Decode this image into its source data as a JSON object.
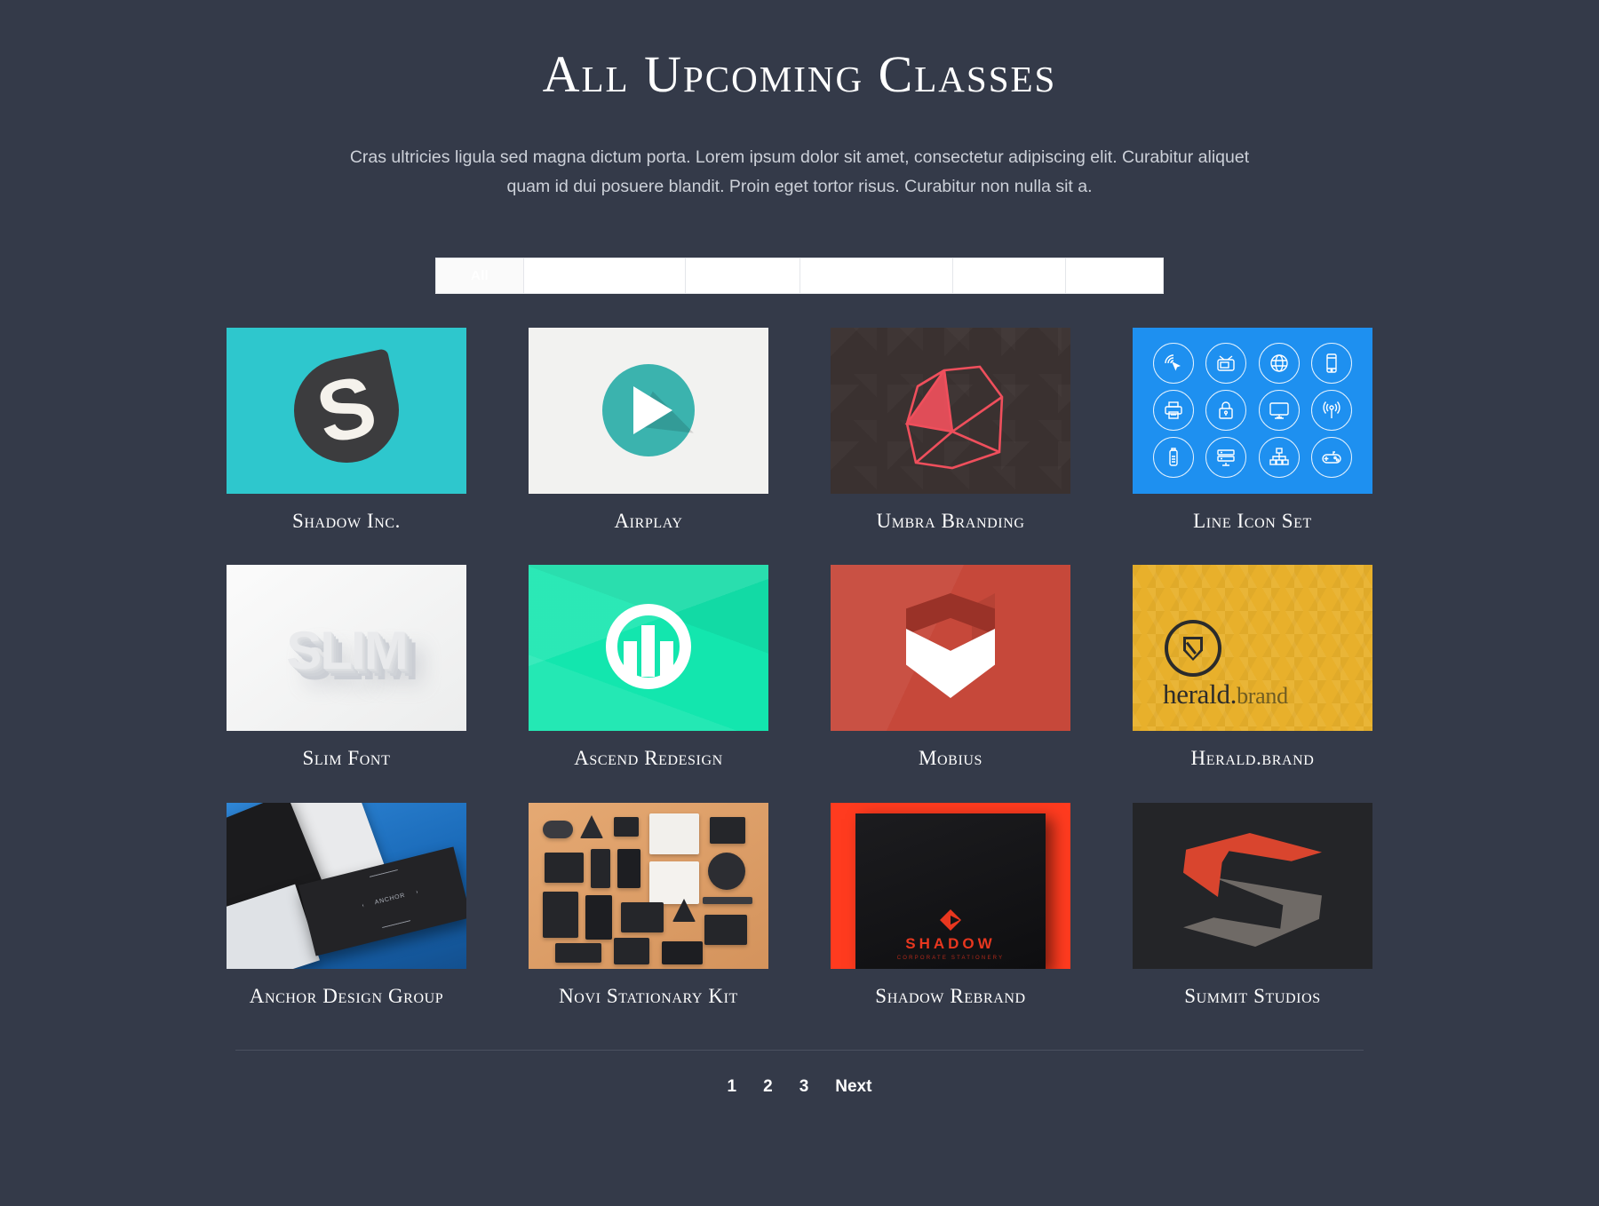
{
  "header": {
    "title": "All Upcoming Classes",
    "intro": "Cras ultricies ligula sed magna dictum porta. Lorem ipsum dolor sit amet, consectetur adipiscing elit. Curabitur aliquet quam id dui posuere blandit. Proin eget tortor risus. Curabitur non nulla sit a."
  },
  "filters": {
    "active": "All",
    "items": [
      {
        "label": "All",
        "active": true
      },
      {
        "label": "",
        "active": false
      },
      {
        "label": "",
        "active": false
      },
      {
        "label": "",
        "active": false
      },
      {
        "label": "",
        "active": false
      },
      {
        "label": "",
        "active": false
      }
    ]
  },
  "cards": [
    {
      "title": "Shadow Inc.",
      "art": "shadow-inc-logo",
      "bg": "#2ec7cd",
      "letter": "S"
    },
    {
      "title": "Airplay",
      "art": "airplay-play-button",
      "bg": "#f2f2f0",
      "accent": "#3bb3ae"
    },
    {
      "title": "Umbra Branding",
      "art": "umbra-wireframe-polyhedron",
      "bg": "#3a3130",
      "accent": "#ef4f5c"
    },
    {
      "title": "Line Icon Set",
      "art": "line-icon-grid",
      "bg": "#1e90f0",
      "icons": [
        "touch-cursor-icon",
        "tv-icon",
        "globe-icon",
        "smartphone-icon",
        "printer-icon",
        "lock-icon",
        "monitor-icon",
        "wifi-antenna-icon",
        "usb-drive-icon",
        "server-icon",
        "sitemap-icon",
        "gamepad-icon"
      ]
    },
    {
      "title": "Slim Font",
      "art": "slim-embossed-type",
      "bg": "#f3f3f3",
      "word": "SLIM"
    },
    {
      "title": "Ascend Redesign",
      "art": "ascend-circle-mark",
      "bg": "#13e6ae"
    },
    {
      "title": "Mobius",
      "art": "mobius-hexagon-chevron",
      "bg": "#c6483a"
    },
    {
      "title": "Herald.brand",
      "art": "herald-shield-mark",
      "bg": "#e8b02b",
      "wordmark": "herald.",
      "wordmark_sub": "brand"
    },
    {
      "title": "Anchor Design Group",
      "art": "anchor-boxes-photo",
      "bg": "#1b6fc0",
      "emboss_label": "ANCHOR"
    },
    {
      "title": "Novi Stationary Kit",
      "art": "novi-stationery-flatlay",
      "bg": "#dd9e66"
    },
    {
      "title": "Shadow Rebrand",
      "art": "shadow-book-photo",
      "bg": "#ff3b1f",
      "book_word": "SHADOW",
      "book_sub": "CORPORATE STATIONERY"
    },
    {
      "title": "Summit Studios",
      "art": "summit-s-logo",
      "bg": "#242528"
    }
  ],
  "pagination": {
    "items": [
      "1",
      "2",
      "3",
      "Next"
    ]
  },
  "theme": {
    "page_bg": "#343a49",
    "text": "#ffffff",
    "muted_text": "#ccd0d8",
    "divider": "#4b515f"
  }
}
